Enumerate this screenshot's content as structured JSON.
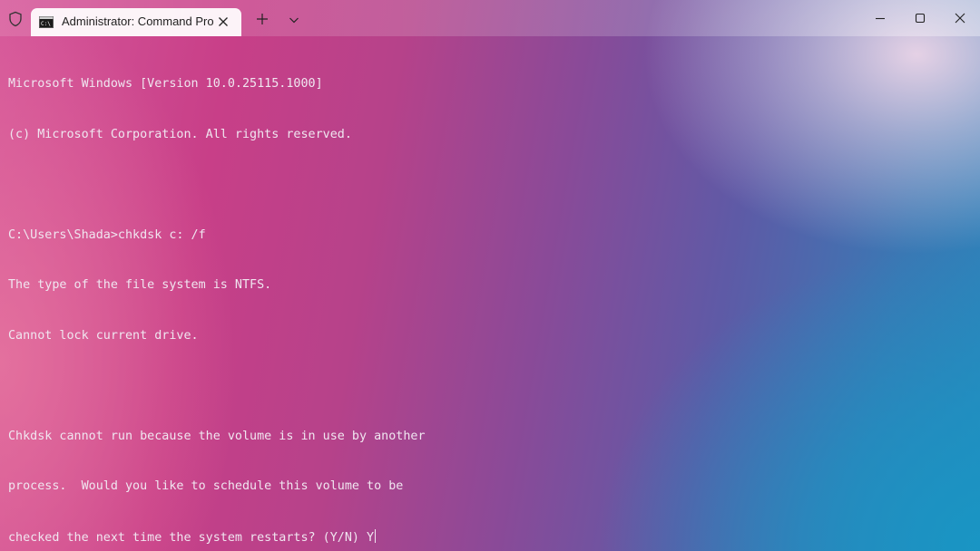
{
  "titlebar": {
    "shield_icon": "shield-icon",
    "tab": {
      "icon": "command-prompt-icon",
      "title": "Administrator: Command Pro",
      "close_icon": "close-icon"
    },
    "new_tab_icon": "plus-icon",
    "dropdown_icon": "chevron-down-icon",
    "window_controls": [
      "minimize-icon",
      "maximize-icon",
      "close-icon"
    ]
  },
  "terminal": {
    "lines": [
      "Microsoft Windows [Version 10.0.25115.1000]",
      "(c) Microsoft Corporation. All rights reserved.",
      "",
      "C:\\Users\\Shada>chkdsk c: /f",
      "The type of the file system is NTFS.",
      "Cannot lock current drive.",
      "",
      "Chkdsk cannot run because the volume is in use by another",
      "process.  Would you like to schedule this volume to be",
      "checked the next time the system restarts? (Y/N) Y"
    ],
    "text_color": "#f0e6f0"
  },
  "colors": {
    "pink": "#c83f88",
    "purple": "#8a4a98",
    "blue": "#2a86bc"
  }
}
